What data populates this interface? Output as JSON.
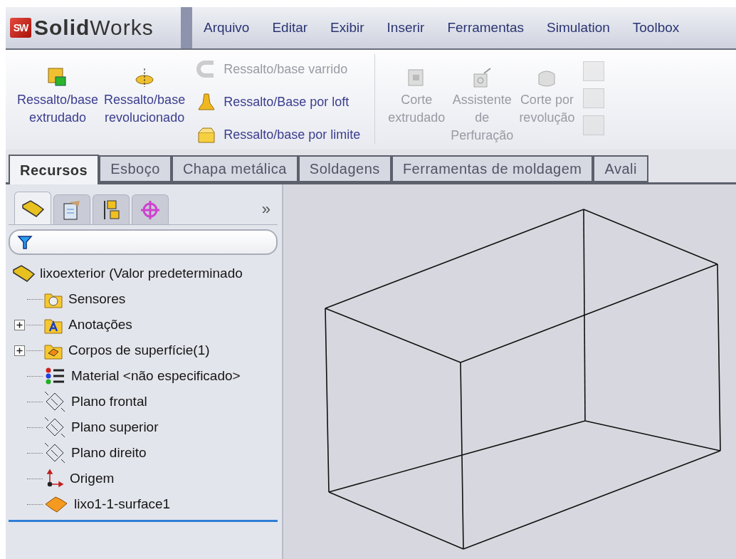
{
  "app": {
    "badge": "SW",
    "name_bold": "Solid",
    "name_rest": "Works"
  },
  "menu": [
    "Arquivo",
    "Editar",
    "Exibir",
    "Inserir",
    "Ferramentas",
    "Simulation",
    "Toolbox"
  ],
  "ribbon": [
    {
      "kind": "large",
      "label": "Ressalto/base\nextrudado",
      "disabled": false
    },
    {
      "kind": "large",
      "label": "Ressalto/base\nrevolucionado",
      "disabled": false
    },
    {
      "kind": "stack",
      "items": [
        {
          "label": "Ressalto/base varrido",
          "disabled": true
        },
        {
          "label": "Ressalto/Base por loft",
          "disabled": false
        },
        {
          "label": "Ressalto/base por limite",
          "disabled": false
        }
      ]
    },
    {
      "kind": "separator"
    },
    {
      "kind": "large",
      "label": "Corte\nextrudado",
      "disabled": true
    },
    {
      "kind": "large",
      "label": "Assistente\nde\nPerfuração",
      "disabled": true
    },
    {
      "kind": "large",
      "label": "Corte por\nrevolução",
      "disabled": true
    },
    {
      "kind": "iconstack",
      "disabled": true
    }
  ],
  "command_tabs": [
    {
      "label": "Recursos",
      "selected": true
    },
    {
      "label": "Esboço",
      "selected": false
    },
    {
      "label": "Chapa metálica",
      "selected": false
    },
    {
      "label": "Soldagens",
      "selected": false
    },
    {
      "label": "Ferramentas de moldagem",
      "selected": false
    },
    {
      "label": "Avali",
      "selected": false
    }
  ],
  "panel_tabs": [
    {
      "kind": "feature",
      "selected": true
    },
    {
      "kind": "property",
      "selected": false
    },
    {
      "kind": "config",
      "selected": false
    },
    {
      "kind": "target",
      "selected": false
    }
  ],
  "panel_more": "»",
  "tree": {
    "label": "lixoexterior  (Valor predeterminado",
    "children": [
      {
        "kind": "sensors",
        "label": "Sensores"
      },
      {
        "kind": "annotations",
        "label": "Anotações",
        "expanded": false
      },
      {
        "kind": "bodies",
        "label": "Corpos de superfície(1)",
        "expanded": false
      },
      {
        "kind": "material",
        "label": "Material <não especificado>"
      },
      {
        "kind": "plane",
        "label": "Plano frontal"
      },
      {
        "kind": "plane",
        "label": "Plano superior"
      },
      {
        "kind": "plane",
        "label": "Plano direito"
      },
      {
        "kind": "origin",
        "label": "Origem"
      },
      {
        "kind": "surface",
        "label": "lixo1-1-surface1"
      }
    ]
  }
}
